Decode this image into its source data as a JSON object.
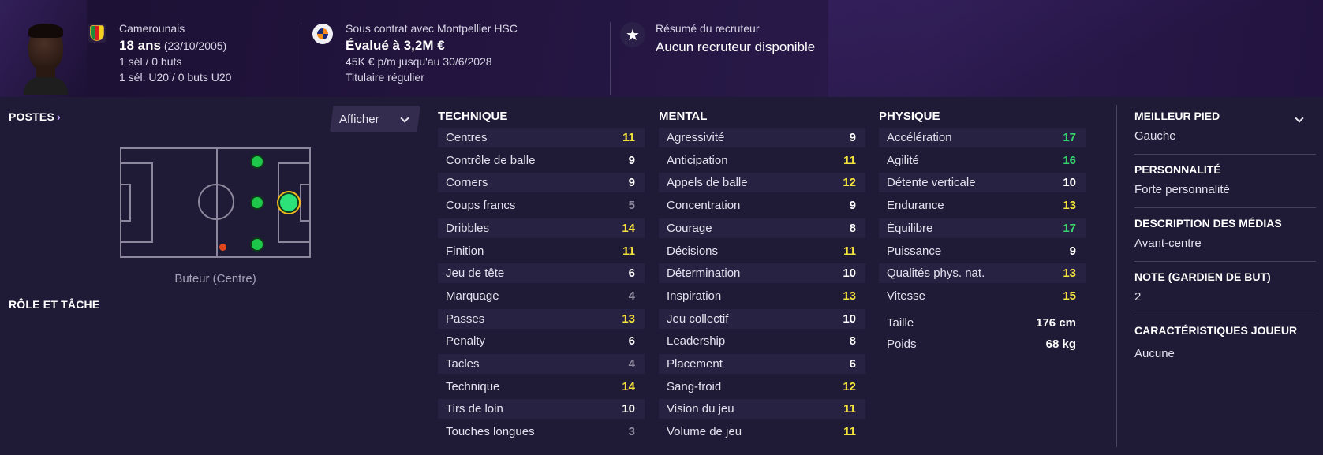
{
  "header": {
    "nationality": "Camerounais",
    "age": "18 ans",
    "birthdate": "(23/10/2005)",
    "caps": "1 sél / 0 buts",
    "youth_caps": "1 sél. U20 / 0 buts U20",
    "contract": "Sous contrat avec Montpellier HSC",
    "value": "Évalué à 3,2M €",
    "wage": "45K € p/m jusqu'au 30/6/2028",
    "status": "Titulaire régulier",
    "scout_title": "Résumé du recruteur",
    "scout_value": "Aucun recruteur disponible"
  },
  "left": {
    "positions_title": "POSTES",
    "afficher_label": "Afficher",
    "position_caption": "Buteur (Centre)",
    "role_title": "RÔLE ET TÂCHE"
  },
  "technique": {
    "title": "TECHNIQUE",
    "rows": [
      {
        "label": "Centres",
        "value": "11",
        "color": "#f3e23b"
      },
      {
        "label": "Contrôle de balle",
        "value": "9",
        "color": "#ffffff"
      },
      {
        "label": "Corners",
        "value": "9",
        "color": "#ffffff"
      },
      {
        "label": "Coups francs",
        "value": "5",
        "color": "#8f8a9e"
      },
      {
        "label": "Dribbles",
        "value": "14",
        "color": "#f3e23b"
      },
      {
        "label": "Finition",
        "value": "11",
        "color": "#f3e23b"
      },
      {
        "label": "Jeu de tête",
        "value": "6",
        "color": "#ffffff"
      },
      {
        "label": "Marquage",
        "value": "4",
        "color": "#8f8a9e"
      },
      {
        "label": "Passes",
        "value": "13",
        "color": "#f3e23b"
      },
      {
        "label": "Penalty",
        "value": "6",
        "color": "#ffffff"
      },
      {
        "label": "Tacles",
        "value": "4",
        "color": "#8f8a9e"
      },
      {
        "label": "Technique",
        "value": "14",
        "color": "#f3e23b"
      },
      {
        "label": "Tirs de loin",
        "value": "10",
        "color": "#ffffff"
      },
      {
        "label": "Touches longues",
        "value": "3",
        "color": "#8f8a9e"
      }
    ]
  },
  "mental": {
    "title": "MENTAL",
    "rows": [
      {
        "label": "Agressivité",
        "value": "9",
        "color": "#ffffff"
      },
      {
        "label": "Anticipation",
        "value": "11",
        "color": "#f3e23b"
      },
      {
        "label": "Appels de balle",
        "value": "12",
        "color": "#f3e23b"
      },
      {
        "label": "Concentration",
        "value": "9",
        "color": "#ffffff"
      },
      {
        "label": "Courage",
        "value": "8",
        "color": "#ffffff"
      },
      {
        "label": "Décisions",
        "value": "11",
        "color": "#f3e23b"
      },
      {
        "label": "Détermination",
        "value": "10",
        "color": "#ffffff"
      },
      {
        "label": "Inspiration",
        "value": "13",
        "color": "#f3e23b"
      },
      {
        "label": "Jeu collectif",
        "value": "10",
        "color": "#ffffff"
      },
      {
        "label": "Leadership",
        "value": "8",
        "color": "#ffffff"
      },
      {
        "label": "Placement",
        "value": "6",
        "color": "#ffffff"
      },
      {
        "label": "Sang-froid",
        "value": "12",
        "color": "#f3e23b"
      },
      {
        "label": "Vision du jeu",
        "value": "11",
        "color": "#f3e23b"
      },
      {
        "label": "Volume de jeu",
        "value": "11",
        "color": "#f3e23b"
      }
    ]
  },
  "physique": {
    "title": "PHYSIQUE",
    "rows": [
      {
        "label": "Accélération",
        "value": "17",
        "color": "#35d56c"
      },
      {
        "label": "Agilité",
        "value": "16",
        "color": "#35d56c"
      },
      {
        "label": "Détente verticale",
        "value": "10",
        "color": "#ffffff"
      },
      {
        "label": "Endurance",
        "value": "13",
        "color": "#f3e23b"
      },
      {
        "label": "Équilibre",
        "value": "17",
        "color": "#35d56c"
      },
      {
        "label": "Puissance",
        "value": "9",
        "color": "#ffffff"
      },
      {
        "label": "Qualités phys. nat.",
        "value": "13",
        "color": "#f3e23b"
      },
      {
        "label": "Vitesse",
        "value": "15",
        "color": "#f3e23b"
      }
    ],
    "height_label": "Taille",
    "height_value": "176 cm",
    "weight_label": "Poids",
    "weight_value": "68 kg"
  },
  "right": {
    "foot_title": "MEILLEUR PIED",
    "foot_value": "Gauche",
    "personality_title": "PERSONNALITÉ",
    "personality_value": "Forte personnalité",
    "media_title": "DESCRIPTION DES MÉDIAS",
    "media_value": "Avant-centre",
    "gk_title": "NOTE (GARDIEN DE BUT)",
    "gk_value": "2",
    "traits_title": "CARACTÉRISTIQUES JOUEUR",
    "traits_value": "Aucune"
  },
  "icons": [
    "cameroon-flag-icon",
    "montpellier-club-icon",
    "star-icon",
    "chevron-right-icon",
    "chevron-down-icon"
  ]
}
